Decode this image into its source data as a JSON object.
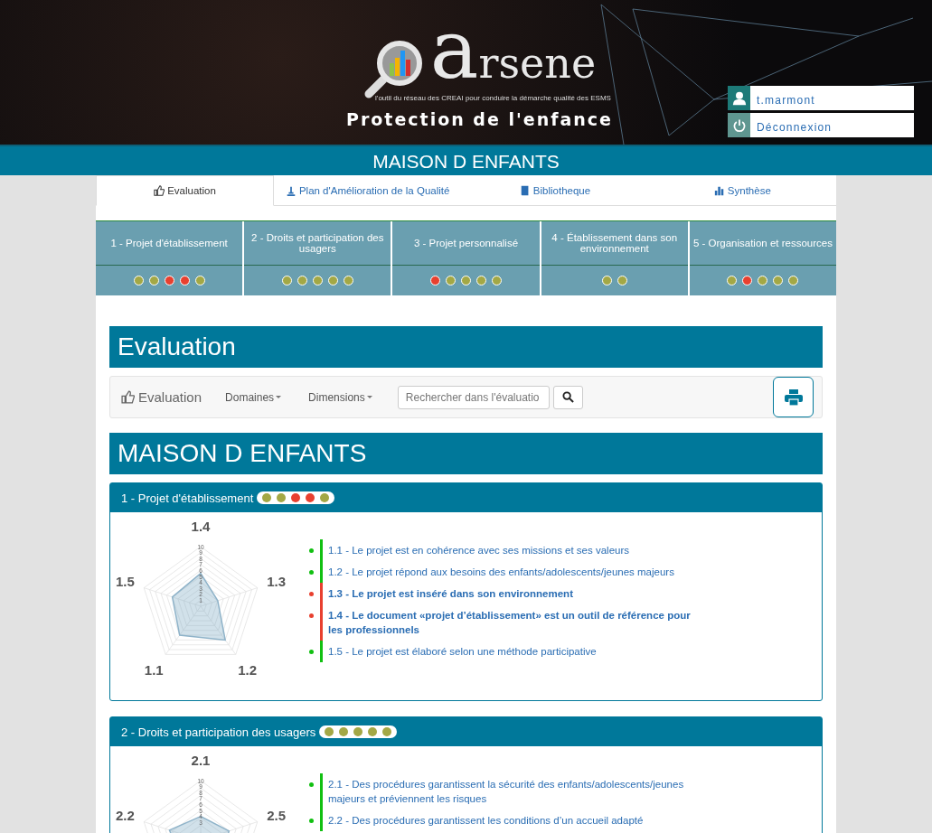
{
  "header": {
    "logo": "arsene",
    "tagline": "l'outil du réseau des CREAI pour conduire la démarche qualité des ESMS",
    "subtitle": "Protection de l'enfance",
    "user": "t.marmont",
    "logout": "Déconnexion"
  },
  "establishment": "MAISON D ENFANTS",
  "tabs": [
    {
      "label": "Evaluation",
      "selected": true
    },
    {
      "label": "Plan d'Amélioration de la Qualité",
      "selected": false
    },
    {
      "label": "Bibliotheque",
      "selected": false
    },
    {
      "label": "Synthèse",
      "selected": false
    }
  ],
  "domains": [
    {
      "label": "1 - Projet d'établissement",
      "dots": [
        {
          "color": "#a3a845"
        },
        {
          "color": "#a3a845"
        },
        {
          "color": "#e8402f"
        },
        {
          "color": "#e8402f"
        },
        {
          "color": "#a3a845"
        }
      ]
    },
    {
      "label": "2 - Droits et participation des usagers",
      "dots": [
        {
          "color": "#a3a845"
        },
        {
          "color": "#a3a845"
        },
        {
          "color": "#a3a845"
        },
        {
          "color": "#a3a845"
        },
        {
          "color": "#a3a845"
        }
      ]
    },
    {
      "label": "3 - Projet personnalisé",
      "dots": [
        {
          "color": "#e8402f"
        },
        {
          "color": "#a3a845"
        },
        {
          "color": "#a3a845"
        },
        {
          "color": "#a3a845"
        },
        {
          "color": "#a3a845"
        }
      ]
    },
    {
      "label": "4 - Établissement dans son environnement",
      "dots": [
        {
          "color": "#a3a845"
        },
        {
          "color": "#a3a845"
        }
      ]
    },
    {
      "label": "5 - Organisation et ressources",
      "dots": [
        {
          "color": "#a3a845"
        },
        {
          "color": "#e8402f"
        },
        {
          "color": "#a3a845"
        },
        {
          "color": "#a3a845"
        },
        {
          "color": "#a3a845"
        }
      ]
    }
  ],
  "page_title": "Evaluation",
  "toolbar": {
    "brand": "Evaluation",
    "menus": [
      "Domaines",
      "Dimensions"
    ],
    "search": {
      "placeholder": "Rechercher dans l'évaluatio"
    }
  },
  "section_title": "MAISON D ENFANTS",
  "panels": [
    {
      "title": "1 - Projet d'établissement",
      "dots": [
        {
          "color": "#a3a845"
        },
        {
          "color": "#a3a845"
        },
        {
          "color": "#e8402f"
        },
        {
          "color": "#e8402f"
        },
        {
          "color": "#a3a845"
        }
      ],
      "radar": {
        "ticks": [
          "10",
          "9",
          "8",
          "7",
          "6",
          "5",
          "4",
          "3",
          "2",
          "1"
        ],
        "labels": [
          "1.4",
          "1.5",
          "1.3",
          "1.1",
          "1.2"
        ]
      },
      "criteria": [
        {
          "text": "1.1 - Le projet est en cohérence avec ses missions et ses valeurs",
          "color": "#11c011",
          "emphasized": false
        },
        {
          "text": "1.2 - Le projet répond aux besoins des enfants/adolescents/jeunes majeurs",
          "color": "#11c011",
          "emphasized": false
        },
        {
          "text": "1.3 - Le projet est inséré dans son environnement",
          "color": "#e8402f",
          "emphasized": true
        },
        {
          "text": "1.4 - Le document «projet d’établissement» est un outil de référence pour les professionnels",
          "color": "#e8402f",
          "emphasized": true
        },
        {
          "text": "1.5 - Le projet est élaboré selon une méthode participative",
          "color": "#11c011",
          "emphasized": false
        }
      ]
    },
    {
      "title": "2 - Droits et participation des usagers",
      "dots": [
        {
          "color": "#a3a845"
        },
        {
          "color": "#a3a845"
        },
        {
          "color": "#a3a845"
        },
        {
          "color": "#a3a845"
        },
        {
          "color": "#a3a845"
        }
      ],
      "radar": {
        "ticks": [
          "10",
          "9",
          "8",
          "7",
          "6",
          "5",
          "4",
          "3"
        ],
        "labels": [
          "2.1",
          "2.2",
          "2.5"
        ]
      },
      "criteria": [
        {
          "text": "2.1 - Des procédures garantissent la sécurité des enfants/adolescents/jeunes majeurs et préviennent les risques",
          "color": "#11c011",
          "emphasized": false
        },
        {
          "text": "2.2 - Des procédures garantissent les conditions d’un accueil adapté",
          "color": "#11c011",
          "emphasized": false
        }
      ]
    }
  ]
}
